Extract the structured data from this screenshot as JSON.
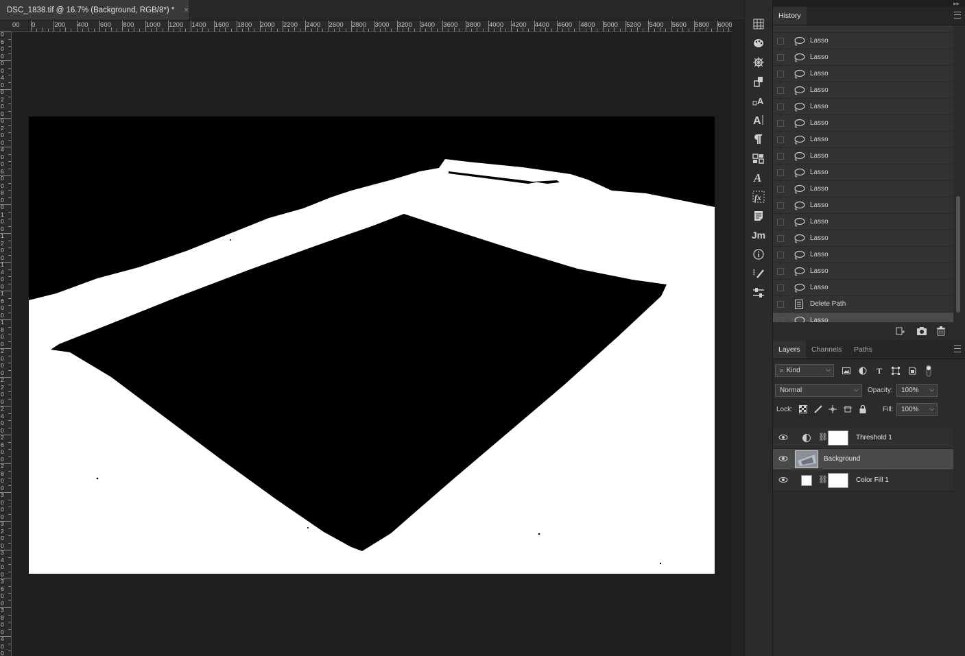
{
  "document_tab": {
    "title": "DSC_1838.tif @ 16.7% (Background, RGB/8*) *",
    "close": "×"
  },
  "ruler": {
    "top_labels": [
      "00",
      "0",
      "200",
      "400",
      "600",
      "800",
      "1000",
      "1200",
      "1400",
      "1600",
      "1800",
      "2000",
      "2200",
      "2400",
      "2600",
      "2800",
      "3000",
      "3200",
      "3400",
      "3600",
      "3800",
      "4000",
      "4200",
      "4400",
      "4600",
      "4800",
      "5000",
      "5200",
      "5400",
      "5600",
      "5800",
      "6000"
    ],
    "left_labels": [
      "0",
      "6",
      "0",
      "0",
      "0",
      "0",
      "4",
      "0",
      "0",
      "2",
      "0",
      "0",
      "0",
      "2",
      "0",
      "0",
      "4",
      "0",
      "0",
      "6",
      "0",
      "0",
      "8",
      "0",
      "0",
      "1",
      "0",
      "0",
      "1",
      "2",
      "0",
      "0",
      "1",
      "4",
      "0",
      "0",
      "1",
      "6",
      "0",
      "0",
      "1",
      "8",
      "0",
      "0",
      "2",
      "0",
      "0",
      "0",
      "2",
      "2",
      "0",
      "0",
      "2",
      "4",
      "0",
      "0",
      "2",
      "6",
      "0",
      "0",
      "2",
      "8",
      "0",
      "0",
      "3",
      "0",
      "0",
      "0",
      "3",
      "2",
      "0",
      "0",
      "3",
      "4",
      "0",
      "0",
      "3",
      "6",
      "0",
      "0",
      "3",
      "8",
      "0",
      "0",
      "4",
      "0",
      "0",
      "0"
    ]
  },
  "dock": {
    "icons": [
      "grid-icon",
      "palette-icon",
      "navigator-icon",
      "clone-source-icon",
      "character-style-icon",
      "character-icon",
      "paragraph-icon",
      "3d-icon",
      "glyphs-icon",
      "fx-icon",
      "notes-icon",
      "jm-icon",
      "info-icon",
      "brush-presets-icon",
      "adjustments-icon"
    ],
    "jm_label": "Jm",
    "fx_label": "fx"
  },
  "history": {
    "title": "History",
    "items": [
      {
        "label": "Lasso",
        "icon": "lasso-icon"
      },
      {
        "label": "Lasso",
        "icon": "lasso-icon"
      },
      {
        "label": "Lasso",
        "icon": "lasso-icon"
      },
      {
        "label": "Lasso",
        "icon": "lasso-icon"
      },
      {
        "label": "Lasso",
        "icon": "lasso-icon"
      },
      {
        "label": "Lasso",
        "icon": "lasso-icon"
      },
      {
        "label": "Lasso",
        "icon": "lasso-icon"
      },
      {
        "label": "Lasso",
        "icon": "lasso-icon"
      },
      {
        "label": "Lasso",
        "icon": "lasso-icon"
      },
      {
        "label": "Lasso",
        "icon": "lasso-icon"
      },
      {
        "label": "Lasso",
        "icon": "lasso-icon"
      },
      {
        "label": "Lasso",
        "icon": "lasso-icon"
      },
      {
        "label": "Lasso",
        "icon": "lasso-icon"
      },
      {
        "label": "Lasso",
        "icon": "lasso-icon"
      },
      {
        "label": "Lasso",
        "icon": "lasso-icon"
      },
      {
        "label": "Lasso",
        "icon": "lasso-icon"
      },
      {
        "label": "Delete Path",
        "icon": "delete-path-icon"
      },
      {
        "label": "Lasso",
        "icon": "lasso-icon"
      }
    ],
    "selected_index": 17
  },
  "layers_panel": {
    "tabs": [
      "Layers",
      "Channels",
      "Paths"
    ],
    "active_tab": "Layers",
    "filter_kind": "Kind",
    "blend_mode": "Normal",
    "opacity_label": "Opacity:",
    "opacity_value": "100%",
    "lock_label": "Lock:",
    "fill_label": "Fill:",
    "fill_value": "100%",
    "layers": [
      {
        "name": "Threshold 1",
        "type": "adjustment",
        "visible": true
      },
      {
        "name": "Background",
        "type": "image",
        "visible": true,
        "selected": true
      },
      {
        "name": "Color Fill 1",
        "type": "fill",
        "visible": true
      }
    ]
  },
  "colors": {
    "selected_row": "#4b4b4b",
    "panel_bg": "#2b2b2b",
    "canvas_black": "#000000",
    "canvas_white": "#ffffff"
  }
}
